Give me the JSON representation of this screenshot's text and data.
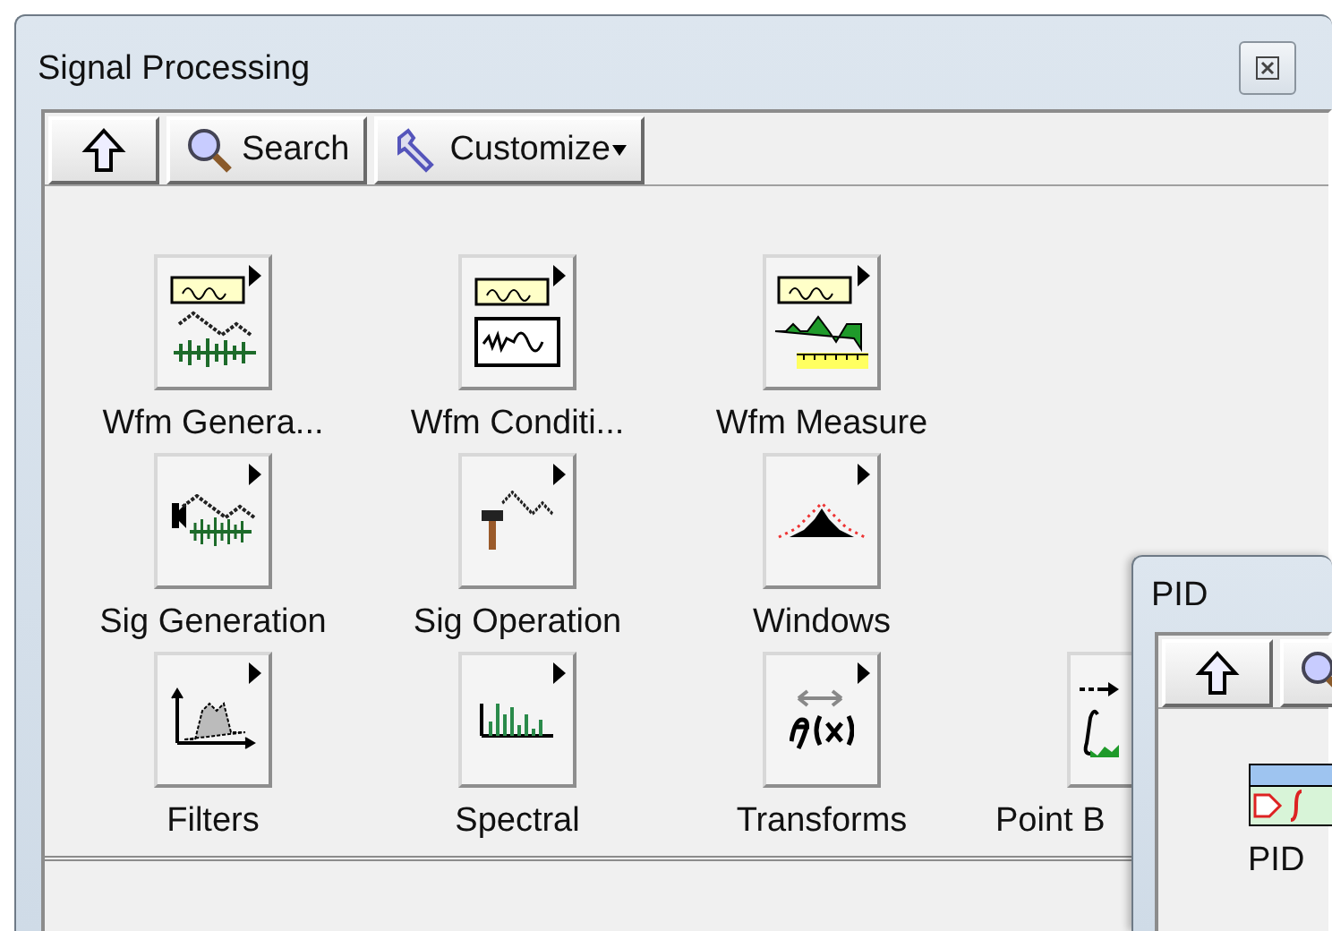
{
  "window": {
    "title": "Signal Processing"
  },
  "toolbar": [
    {
      "kind": "up"
    },
    {
      "kind": "search",
      "label": "Search"
    },
    {
      "kind": "customize",
      "label": "Customize",
      "dropdown": true
    }
  ],
  "items": [
    {
      "label": "Wfm Genera...",
      "kind": "wfm-generation",
      "submenu": true
    },
    {
      "label": "Wfm Conditi...",
      "kind": "wfm-conditioning",
      "submenu": true
    },
    {
      "label": "Wfm Measure",
      "kind": "wfm-measure",
      "submenu": true
    },
    {
      "kind": "empty"
    },
    {
      "label": "Sig Generation",
      "kind": "sig-generation",
      "submenu": true
    },
    {
      "label": "Sig Operation",
      "kind": "sig-operation",
      "submenu": true
    },
    {
      "label": "Windows",
      "kind": "windows",
      "submenu": true
    },
    {
      "kind": "empty"
    },
    {
      "label": "Filters",
      "kind": "filters",
      "submenu": true
    },
    {
      "label": "Spectral",
      "kind": "spectral",
      "submenu": true
    },
    {
      "label": "Transforms",
      "kind": "transforms",
      "submenu": true
    },
    {
      "label": "Point B",
      "kind": "point-by-point"
    }
  ],
  "pid_window": {
    "title": "PID",
    "toolbar": [
      {
        "kind": "up"
      },
      {
        "kind": "search"
      }
    ],
    "items": [
      {
        "label": "PID",
        "kind": "pid"
      }
    ]
  }
}
